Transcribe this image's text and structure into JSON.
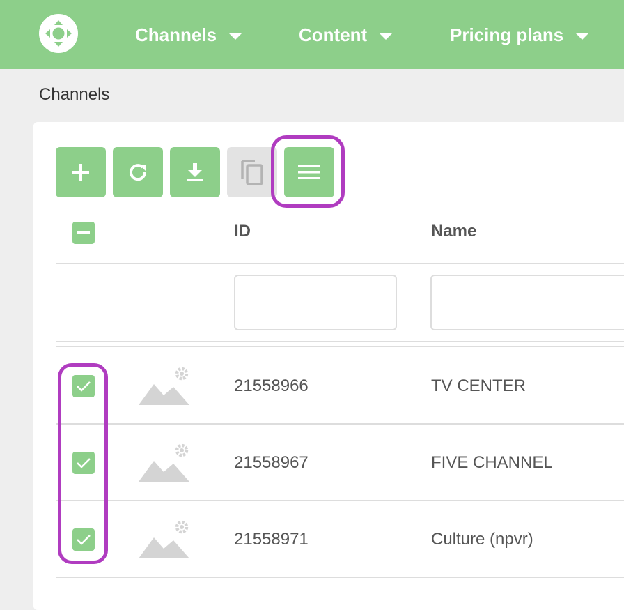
{
  "nav": {
    "items": [
      {
        "label": "Channels"
      },
      {
        "label": "Content"
      },
      {
        "label": "Pricing plans"
      }
    ]
  },
  "breadcrumb": "Channels",
  "toolbar": {
    "buttons": [
      {
        "icon": "plus-icon"
      },
      {
        "icon": "refresh-icon"
      },
      {
        "icon": "download-icon"
      },
      {
        "icon": "copy-icon",
        "disabled": true
      },
      {
        "icon": "menu-icon",
        "highlighted": true
      }
    ]
  },
  "table": {
    "columns": [
      "ID",
      "Name"
    ],
    "filters": {
      "id": "",
      "name": ""
    },
    "rows": [
      {
        "id": "21558966",
        "name": "TV CENTER",
        "checked": true
      },
      {
        "id": "21558967",
        "name": "FIVE CHANNEL",
        "checked": true
      },
      {
        "id": "21558971",
        "name": "Culture (npvr)",
        "checked": true
      }
    ]
  },
  "colors": {
    "brand_green": "#8dcf8a",
    "highlight_purple": "#b03cc0",
    "disabled_gray": "#e3e3e3"
  }
}
